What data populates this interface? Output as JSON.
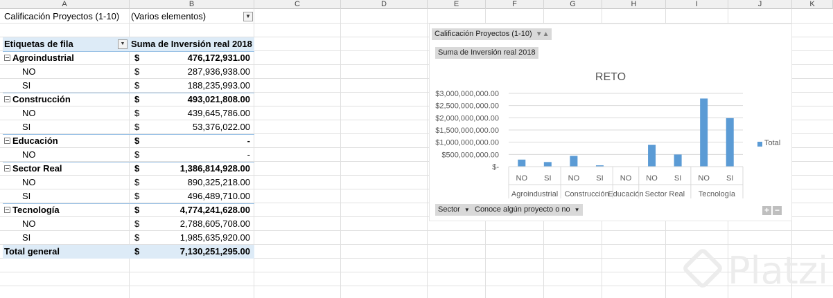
{
  "columns": [
    "A",
    "B",
    "C",
    "D",
    "E",
    "F",
    "G",
    "H",
    "I",
    "J",
    "K"
  ],
  "filter": {
    "label": "Calificación Proyectos (1-10)",
    "value": "(Varios elementos)"
  },
  "pivot": {
    "row_header": "Etiquetas de fila",
    "value_header": "Suma de Inversión real 2018",
    "currency": "$",
    "rows": [
      {
        "label": "Agroindustrial",
        "value": "476,172,931.00",
        "level": 0
      },
      {
        "label": "NO",
        "value": "287,936,938.00",
        "level": 1
      },
      {
        "label": "SI",
        "value": "188,235,993.00",
        "level": 1
      },
      {
        "label": "Construcción",
        "value": "493,021,808.00",
        "level": 0
      },
      {
        "label": "NO",
        "value": "439,645,786.00",
        "level": 1
      },
      {
        "label": "SI",
        "value": "53,376,022.00",
        "level": 1
      },
      {
        "label": "Educación",
        "value": "-",
        "level": 0
      },
      {
        "label": "NO",
        "value": "-",
        "level": 1
      },
      {
        "label": "Sector Real",
        "value": "1,386,814,928.00",
        "level": 0
      },
      {
        "label": "NO",
        "value": "890,325,218.00",
        "level": 1
      },
      {
        "label": "SI",
        "value": "496,489,710.00",
        "level": 1
      },
      {
        "label": "Tecnología",
        "value": "4,774,241,628.00",
        "level": 0
      },
      {
        "label": "NO",
        "value": "2,788,605,708.00",
        "level": 1
      },
      {
        "label": "SI",
        "value": "1,985,635,920.00",
        "level": 1
      }
    ],
    "total": {
      "label": "Total general",
      "value": "7,130,251,295.00"
    }
  },
  "chart_data": {
    "type": "bar",
    "title": "RETO",
    "filter_button": "Calificación Proyectos (1-10)",
    "value_button": "Suma de Inversión real 2018",
    "axis_buttons": [
      "Sector",
      "Conoce algún proyecto o no"
    ],
    "legend": "Total",
    "legend_position": "right",
    "ylim": [
      0,
      3000000000
    ],
    "yticks": [
      "$-",
      "$500,000,000.00",
      "$1,000,000,000.00",
      "$1,500,000,000.00",
      "$2,000,000,000.00",
      "$2,500,000,000.00",
      "$3,000,000,000.00"
    ],
    "groups": [
      {
        "name": "Agroindustrial",
        "categories": [
          "NO",
          "SI"
        ],
        "values": [
          287936938,
          188235993
        ]
      },
      {
        "name": "Construcción",
        "categories": [
          "NO",
          "SI"
        ],
        "values": [
          439645786,
          53376022
        ]
      },
      {
        "name": "Educación",
        "categories": [
          "NO"
        ],
        "values": [
          0
        ]
      },
      {
        "name": "Sector Real",
        "categories": [
          "NO",
          "SI"
        ],
        "values": [
          890325218,
          496489710
        ]
      },
      {
        "name": "Tecnología",
        "categories": [
          "NO",
          "SI"
        ],
        "values": [
          2788605708,
          1985635920
        ]
      }
    ],
    "bar_color": "#5b9bd5",
    "grid": true
  },
  "watermark": "Platzi"
}
